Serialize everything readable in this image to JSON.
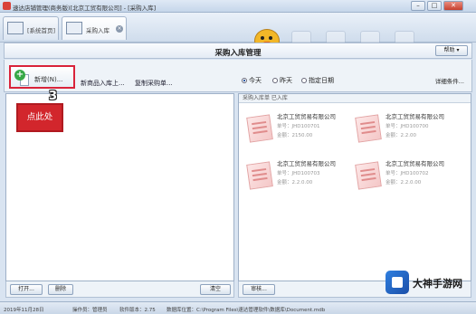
{
  "window": {
    "title": "速达店铺管理(商务版)[北京工贸有限公司] - [采购入库]",
    "controls": {
      "minimize": "–",
      "maximize": "□",
      "close": "✕"
    }
  },
  "tabs": [
    {
      "label": "[系统首页]",
      "icon": "home-screen-icon"
    },
    {
      "label": "采购入库",
      "icon": "truck-icon",
      "close": "×"
    }
  ],
  "panel": {
    "title": "采购入库管理",
    "help": "帮助 ▾"
  },
  "toolbar": {
    "new_label": "新增(N)...",
    "link1": "新商品入库上...",
    "link2": "复制采购单...",
    "radios": [
      "今天",
      "昨天",
      "指定日期"
    ],
    "selected_radio": "今天",
    "more": "详细条件..."
  },
  "annotation": {
    "step": "3",
    "callout": "点此处"
  },
  "right_pane": {
    "caption": "采购入库单 已入库",
    "orders": [
      {
        "supplier": "北京工贸贸易有限公司",
        "line1": "单号：JHD100701",
        "line2": "金额：2150.00"
      },
      {
        "supplier": "北京工贸贸易有限公司",
        "line1": "单号：JHD100700",
        "line2": "金额：2.2.00"
      },
      {
        "supplier": "北京工贸贸易有限公司",
        "line1": "单号：JHD100703",
        "line2": "金额：2.2.0.00"
      },
      {
        "supplier": "北京工贸贸易有限公司",
        "line1": "单号：JHD100702",
        "line2": "金额：2.2.0.00"
      }
    ]
  },
  "bottom": {
    "open": "打开...",
    "delete": "删除",
    "clear": "清空",
    "audit": "审核..."
  },
  "status": {
    "date": "2019年11月28日",
    "operator": "操作员：管理员",
    "version": "软件版本：2.75",
    "path": "数据库位置：C:\\Program Files\\速达管理软件\\数据库\\Document.mdb"
  },
  "watermark": {
    "text": "大神手游网"
  }
}
